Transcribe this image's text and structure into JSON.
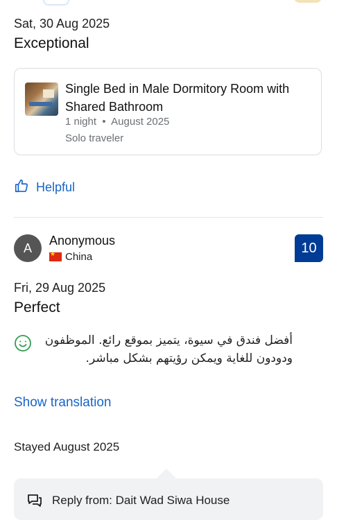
{
  "review1": {
    "date": "Sat, 30 Aug 2025",
    "title": "Exceptional",
    "room": {
      "name": "Single Bed in Male Dormitory Room with Shared Bathroom",
      "nights": "1 night",
      "month": "August 2025",
      "traveler": "Solo traveler"
    },
    "helpful_label": "Helpful"
  },
  "review2": {
    "reviewer": "Anonymous",
    "country": "China",
    "score": "10",
    "date": "Fri, 29 Aug 2025",
    "title": "Perfect",
    "text": "أفضل فندق في سيوة، يتميز بموقع رائع. الموظفون ودودون للغاية ويمكن رؤيتهم بشكل مباشر.",
    "show_translation": "Show translation",
    "stayed": "Stayed August 2025",
    "reply": "Reply from: Dait Wad Siwa House"
  },
  "colors": {
    "link": "#1865c9",
    "score_bg": "#003b95",
    "smile": "#2e9e4f"
  },
  "icons": {
    "helpful": "thumbs-up-icon",
    "positive": "smile-icon",
    "reply": "chat-bubble-icon",
    "flag": "china-flag-icon"
  }
}
